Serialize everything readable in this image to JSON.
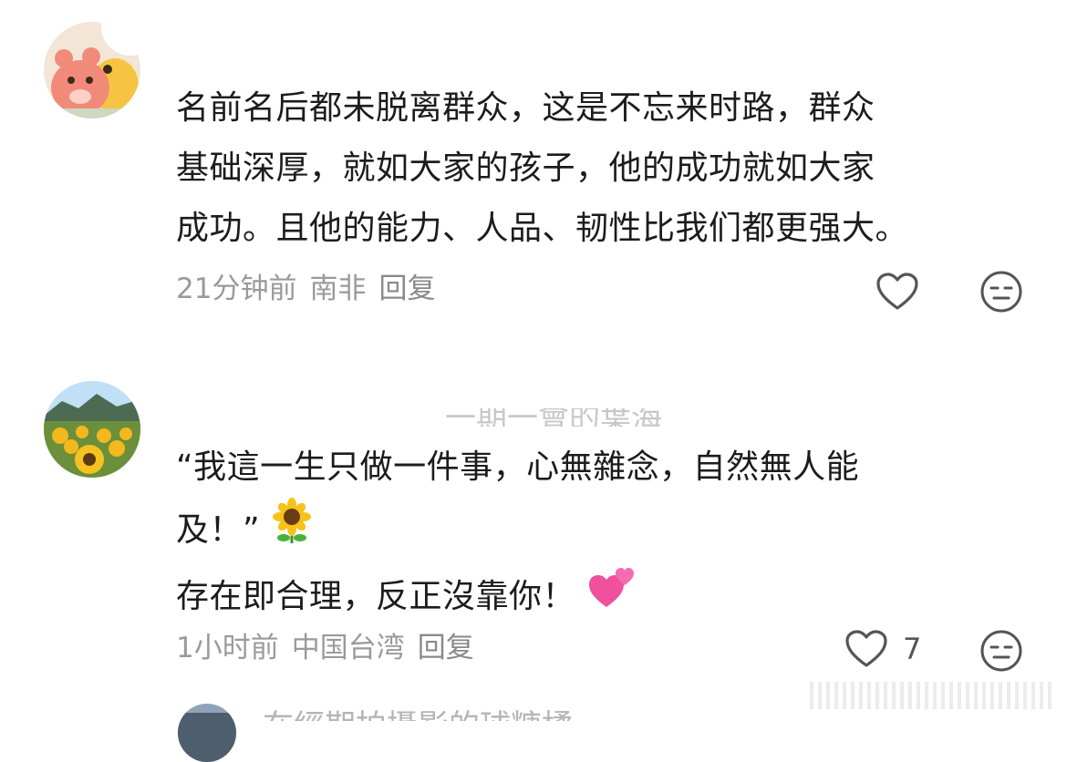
{
  "comments": [
    {
      "text_lines": [
        "名前名后都未脱离群众，这是不忘来时路，群众",
        "基础深厚，就如大家的孩子，他的成功就如大家",
        "成功。且他的能力、人品、韧性比我们都更强大。"
      ],
      "time": "21分钟前",
      "location": "南非",
      "reply_label": "回复",
      "like_count": ""
    },
    {
      "username": "一期一會的葉海",
      "text_lines": [
        "“我這一生只做一件事，心無雜念，自然無人能",
        "及！”",
        "存在即合理，反正沒靠你！"
      ],
      "emojis": [
        "sunflower",
        "two-hearts"
      ],
      "time": "1小时前",
      "location": "中国台湾",
      "reply_label": "回复",
      "like_count": "7"
    },
    {
      "username": "在經期拍攝影的球糖橘"
    }
  ],
  "colors": {
    "text": "#1c1c1c",
    "meta": "#9a9a9a",
    "icon": "#555555"
  }
}
